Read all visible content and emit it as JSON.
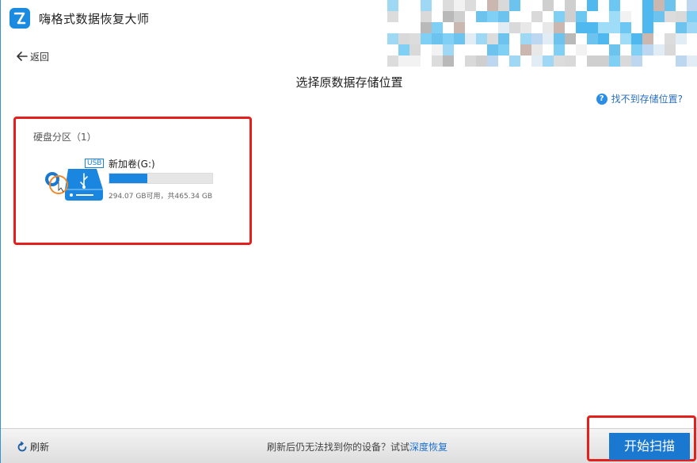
{
  "app": {
    "title": "嗨格式数据恢复大师",
    "brand_color": "#1a8be0"
  },
  "nav": {
    "back_label": "返回"
  },
  "heading": "选择原数据存储位置",
  "help_link": "找不到存储位置?",
  "partitions": {
    "section_title": "硬盘分区（1）",
    "drives": [
      {
        "tag": "USB",
        "name": "新加卷(G:)",
        "used_fraction": 0.37,
        "size_text": "294.07 GB可用，共465.34 GB",
        "icon": "usb-drive-icon"
      }
    ]
  },
  "footer": {
    "refresh_label": "刷新",
    "hint_text": "刷新后仍无法找到你的设备？试试",
    "deep_recovery_label": "深度恢复",
    "scan_button_label": "开始扫描"
  },
  "colors": {
    "accent": "#1a78d0",
    "highlight": "#e3201c"
  }
}
